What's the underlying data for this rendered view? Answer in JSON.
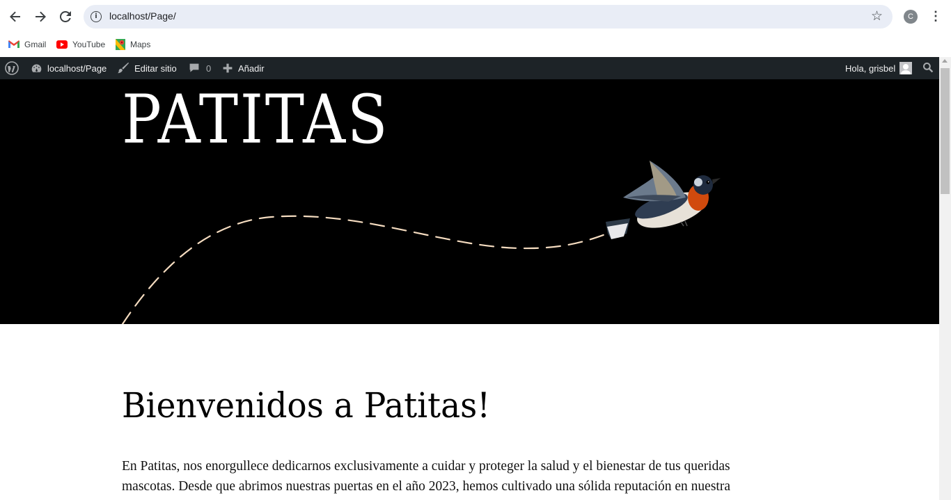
{
  "browser": {
    "url": "localhost/Page/",
    "profile_initial": "C",
    "bookmarks": [
      {
        "label": "Gmail",
        "icon": "gmail-icon"
      },
      {
        "label": "YouTube",
        "icon": "youtube-icon"
      },
      {
        "label": "Maps",
        "icon": "maps-icon"
      }
    ]
  },
  "adminbar": {
    "site_name": "localhost/Page",
    "edit_site": "Editar sitio",
    "comments_count": "0",
    "add_new": "Añadir",
    "greeting": "Hola, grisbel"
  },
  "hero": {
    "site_title": "PATITAS",
    "dash_color": "#f5dcc0"
  },
  "main": {
    "heading": "Bienvenidos a Patitas!",
    "paragraph": "En Patitas, nos enorgullece dedicarnos exclusivamente a cuidar y proteger la salud y el bienestar de tus queridas mascotas. Desde que abrimos nuestras puertas en el año 2023, hemos cultivado una sólida reputación en nuestra"
  },
  "colors": {
    "adminbar_bg": "#1d2327",
    "hero_bg": "#000000",
    "omnibox_bg": "#e9edf6"
  }
}
